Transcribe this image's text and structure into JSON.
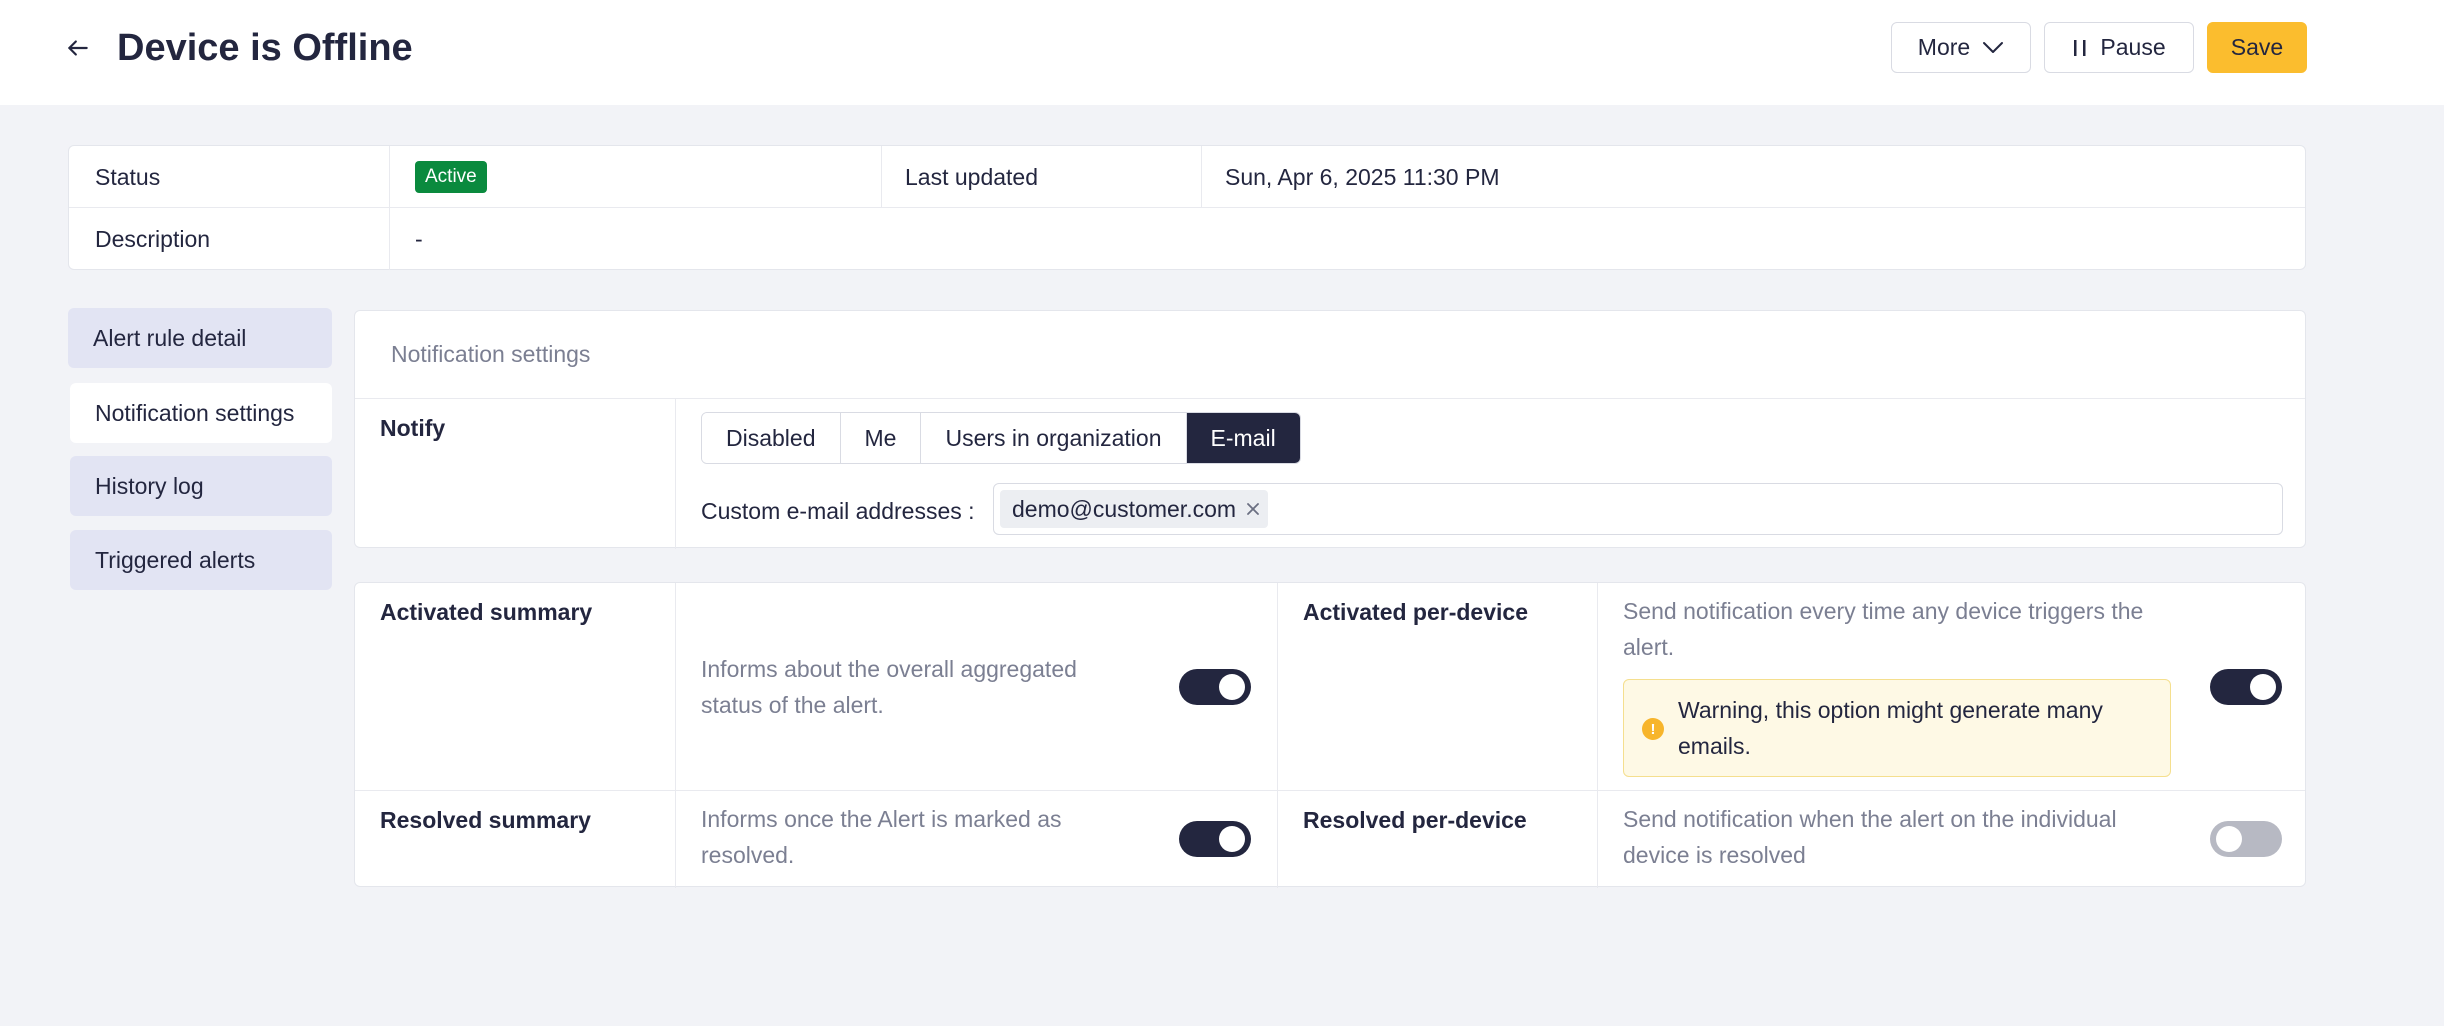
{
  "header": {
    "title": "Device is Offline",
    "more_label": "More",
    "pause_label": "Pause",
    "save_label": "Save"
  },
  "info": {
    "status_label": "Status",
    "status_value": "Active",
    "last_updated_label": "Last updated",
    "last_updated_value": "Sun, Apr 6, 2025 11:30 PM",
    "description_label": "Description",
    "description_value": "-"
  },
  "sidebar": {
    "items": [
      {
        "label": "Alert rule detail",
        "active": false
      },
      {
        "label": "Notification settings",
        "active": true
      },
      {
        "label": "History log",
        "active": false
      },
      {
        "label": "Triggered alerts",
        "active": false
      }
    ]
  },
  "notification": {
    "heading": "Notification settings",
    "notify_label": "Notify",
    "options": [
      "Disabled",
      "Me",
      "Users in organization",
      "E-mail"
    ],
    "selected_option": "E-mail",
    "email_label": "Custom e-mail addresses :",
    "emails": [
      "demo@customer.com"
    ]
  },
  "summary": {
    "activated_summary": {
      "label": "Activated summary",
      "description": "Informs about the overall aggregated status of the alert.",
      "enabled": true
    },
    "activated_per_device": {
      "label": "Activated per-device",
      "description": "Send notification every time any device triggers the alert.",
      "warning": "Warning, this option might generate many emails.",
      "enabled": true
    },
    "resolved_summary": {
      "label": "Resolved summary",
      "description": "Informs once the Alert is marked as resolved.",
      "enabled": true
    },
    "resolved_per_device": {
      "label": "Resolved per-device",
      "description": "Send notification when the alert on the individual device is resolved",
      "enabled": false
    }
  },
  "colors": {
    "accent": "#fbbd2e",
    "dark": "#23263f",
    "active_badge": "#0a8a3e",
    "warning_bg": "#fef9e5"
  }
}
